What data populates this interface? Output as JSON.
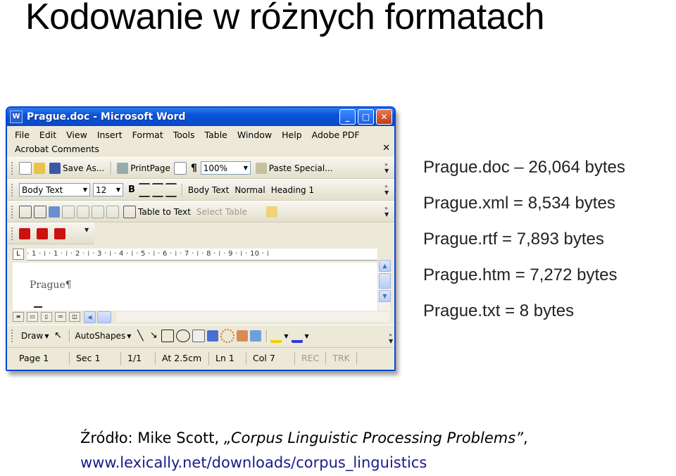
{
  "slide": {
    "title": "Kodowanie w różnych formatach",
    "file_sizes": [
      "Prague.doc – 26,064 bytes",
      "Prague.xml = 8,534 bytes",
      "Prague.rtf = 7,893 bytes",
      "Prague.htm = 7,272 bytes",
      "Prague.txt = 8 bytes"
    ],
    "source_prefix": "Źródło:  Mike Scott, ",
    "source_work": "„Corpus Linguistic Processing Problems”",
    "source_suffix": ",",
    "source_url": "www.lexically.net/downloads/corpus_linguistics"
  },
  "word": {
    "window_title": "Prague.doc - Microsoft Word",
    "title_buttons": [
      "_",
      "□",
      "✕"
    ],
    "menu": [
      "File",
      "Edit",
      "View",
      "Insert",
      "Format",
      "Tools",
      "Table",
      "Window",
      "Help",
      "Adobe PDF"
    ],
    "menu2": [
      "Acrobat Comments"
    ],
    "menu_close": "✕",
    "toolbar1": {
      "save_as": "Save As...",
      "print_page": "PrintPage",
      "pilcrow": "¶",
      "zoom": "100%",
      "paste_special": "Paste Special..."
    },
    "toolbar2": {
      "style": "Body Text",
      "size": "12",
      "bold": "B",
      "style_a": "Body Text",
      "style_b": "Normal",
      "style_c": "Heading 1"
    },
    "toolbar3": {
      "table_to_text": "Table to Text",
      "select_table": "Select Table"
    },
    "ruler": "· 1 · ⁞ · 1 · ⁞ · 2 · ⁞ · 3 · ⁞ · 4 · ⁞ · 5 · ⁞ · 6 · ⁞ · 7 · ⁞ · 8 · ⁞ · 9 · ⁞ · 10 · ⁞",
    "document_text": "Prague¶",
    "draw_toolbar": {
      "draw": "Draw",
      "autoshapes": "AutoShapes"
    },
    "status": {
      "page": "Page 1",
      "sec": "Sec 1",
      "pages": "1/1",
      "at": "At 2.5cm",
      "ln": "Ln 1",
      "col": "Col 7",
      "rec": "REC",
      "trk": "TRK"
    },
    "colors": {
      "titlebar": "#0a53d8",
      "chrome": "#ece9d8",
      "pdf_red": "#cc1111"
    }
  }
}
